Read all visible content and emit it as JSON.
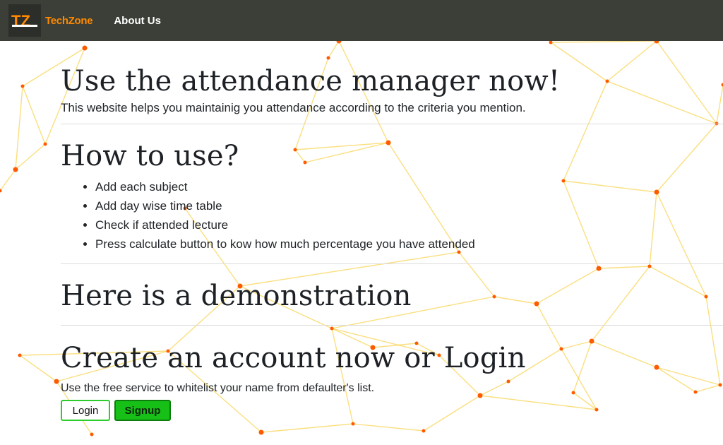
{
  "nav": {
    "logo_letters": "TZ",
    "brand": "TechZone",
    "about_link": "About Us"
  },
  "hero": {
    "title": "Use the attendance manager now!",
    "description": "This website helps you maintainig you attendance according to the criteria you mention."
  },
  "how_to": {
    "title": "How to use?",
    "steps": [
      "Add each subject",
      "Add day wise time table",
      "Check if attended lecture",
      "Press calculate button to kow how much percentage you have attended"
    ]
  },
  "demo": {
    "title": "Here is a demonstration"
  },
  "account": {
    "title": "Create an account now or Login",
    "description": "Use the free service to whitelist your name from defaulter's list.",
    "login_label": "Login",
    "signup_label": "Signup"
  },
  "colors": {
    "navbar": "#3b3f37",
    "brand_orange": "#ff8a00",
    "network_line": "#f5c518",
    "network_node": "#ff5a00",
    "signup_green": "#17c017"
  }
}
